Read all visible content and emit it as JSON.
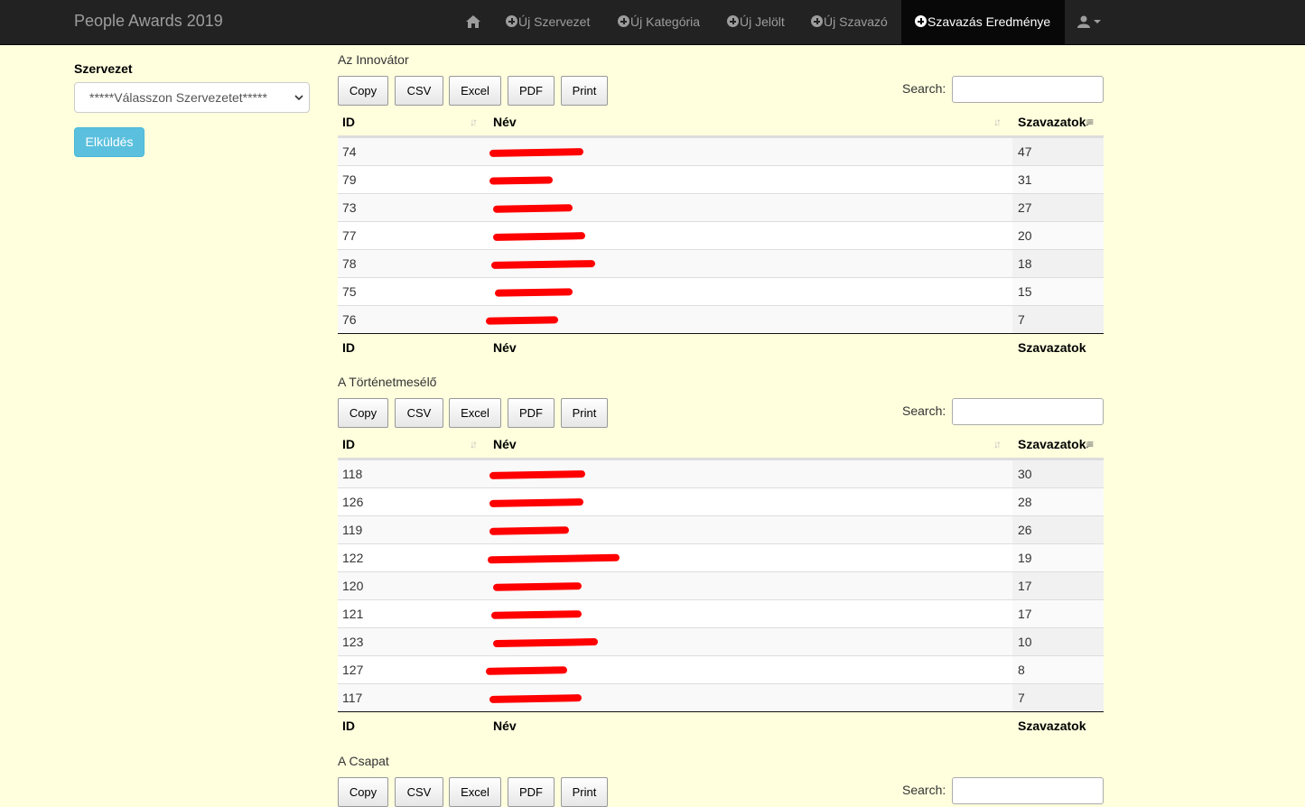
{
  "navbar": {
    "brand": "People Awards 2019",
    "items": [
      {
        "label": "Új Szervezet"
      },
      {
        "label": "Új Kategória"
      },
      {
        "label": "Új Jelölt"
      },
      {
        "label": "Új Szavazó"
      },
      {
        "label": "Szavazás Eredménye"
      }
    ]
  },
  "sidebar": {
    "label": "Szervezet",
    "select_value": "*****Válasszon Szervezetet*****",
    "submit_label": "Elküldés"
  },
  "toolbar": {
    "buttons": [
      "Copy",
      "CSV",
      "Excel",
      "PDF",
      "Print"
    ],
    "search_label": "Search:"
  },
  "columns": {
    "id": "ID",
    "name": "Név",
    "votes": "Szavazatok"
  },
  "sections": [
    {
      "title": "Az Innovátor",
      "rows": [
        {
          "id": "74",
          "votes": "47"
        },
        {
          "id": "79",
          "votes": "31"
        },
        {
          "id": "73",
          "votes": "27"
        },
        {
          "id": "77",
          "votes": "20"
        },
        {
          "id": "78",
          "votes": "18"
        },
        {
          "id": "75",
          "votes": "15"
        },
        {
          "id": "76",
          "votes": "7"
        }
      ]
    },
    {
      "title": "A Történetmesélő",
      "rows": [
        {
          "id": "118",
          "votes": "30"
        },
        {
          "id": "126",
          "votes": "28"
        },
        {
          "id": "119",
          "votes": "26"
        },
        {
          "id": "122",
          "votes": "19"
        },
        {
          "id": "120",
          "votes": "17"
        },
        {
          "id": "121",
          "votes": "17"
        },
        {
          "id": "123",
          "votes": "10"
        },
        {
          "id": "127",
          "votes": "8"
        },
        {
          "id": "117",
          "votes": "7"
        }
      ]
    },
    {
      "title": "A Csapat",
      "rows": []
    }
  ]
}
